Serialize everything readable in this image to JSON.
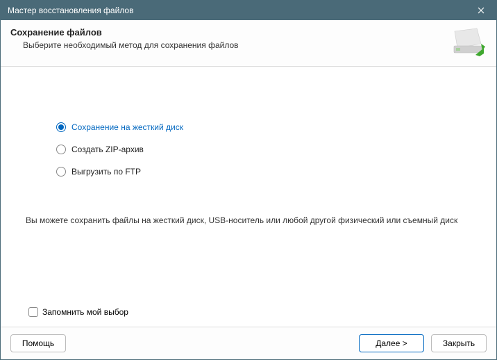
{
  "window": {
    "title": "Мастер восстановления файлов"
  },
  "header": {
    "title": "Сохранение файлов",
    "subtitle": "Выберите необходимый метод для сохранения файлов"
  },
  "options": {
    "hdd": "Сохранение на жесткий диск",
    "zip": "Создать ZIP-архив",
    "ftp": "Выгрузить по FTP",
    "selected": "hdd"
  },
  "description": "Вы можете сохранить файлы на жесткий диск, USB-носитель или любой другой физический или съемный диск",
  "remember_label": "Запомнить мой выбор",
  "buttons": {
    "help": "Помощь",
    "next": "Далее >",
    "close": "Закрыть"
  }
}
